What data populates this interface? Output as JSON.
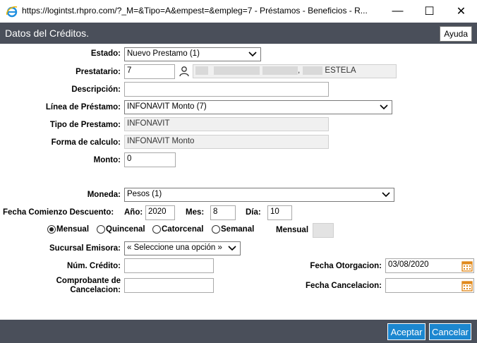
{
  "window": {
    "url": "https://logintst.rhpro.com/?_M=&Tipo=A&empest=&empleg=7 - Préstamos - Beneficios - R...",
    "minimize": "—",
    "maximize": "☐",
    "close": "✕"
  },
  "header": {
    "title": "Datos del Créditos.",
    "help_label": "Ayuda"
  },
  "form": {
    "estado_label": "Estado:",
    "estado_value": "Nuevo Prestamo (1)",
    "prestatario_label": "Prestatario:",
    "prestatario_id": "7",
    "prestatario_name": "ESTELA",
    "descripcion_label": "Descripción:",
    "descripcion_value": "",
    "linea_label": "Línea de Préstamo:",
    "linea_value": "INFONAVIT Monto (7)",
    "tipo_label": "Tipo de Prestamo:",
    "tipo_value": "INFONAVIT",
    "forma_label": "Forma de calculo:",
    "forma_value": "INFONAVIT Monto",
    "monto_label": "Monto:",
    "monto_value": "0",
    "moneda_label": "Moneda:",
    "moneda_value": "Pesos (1)",
    "fecha_comienzo_label": "Fecha Comienzo Descuento:",
    "anio_label": "Año:",
    "anio_value": "2020",
    "mes_label": "Mes:",
    "mes_value": "8",
    "dia_label": "Día:",
    "dia_value": "10",
    "frecuencias": [
      "Mensual",
      "Quincenal",
      "Catorcenal",
      "Semanal"
    ],
    "frecuencia_selected": "Mensual",
    "mensual_label": "Mensual",
    "mensual_value": "",
    "sucursal_label": "Sucursal Emisora:",
    "sucursal_value": "« Seleccione una opción »",
    "num_credito_label": "Núm. Crédito:",
    "num_credito_value": "",
    "comprobante_label_1": "Comprobante de",
    "comprobante_label_2": "Cancelacion:",
    "comprobante_value": "",
    "fecha_otorgacion_label": "Fecha Otorgacion:",
    "fecha_otorgacion_value": "03/08/2020",
    "fecha_cancelacion_label": "Fecha Cancelacion:",
    "fecha_cancelacion_value": ""
  },
  "footer": {
    "accept_label": "Aceptar",
    "cancel_label": "Cancelar"
  },
  "colors": {
    "header_bg": "#4a4f5a",
    "button_blue": "#1c87d0",
    "calendar_orange": "#e08a1e"
  }
}
